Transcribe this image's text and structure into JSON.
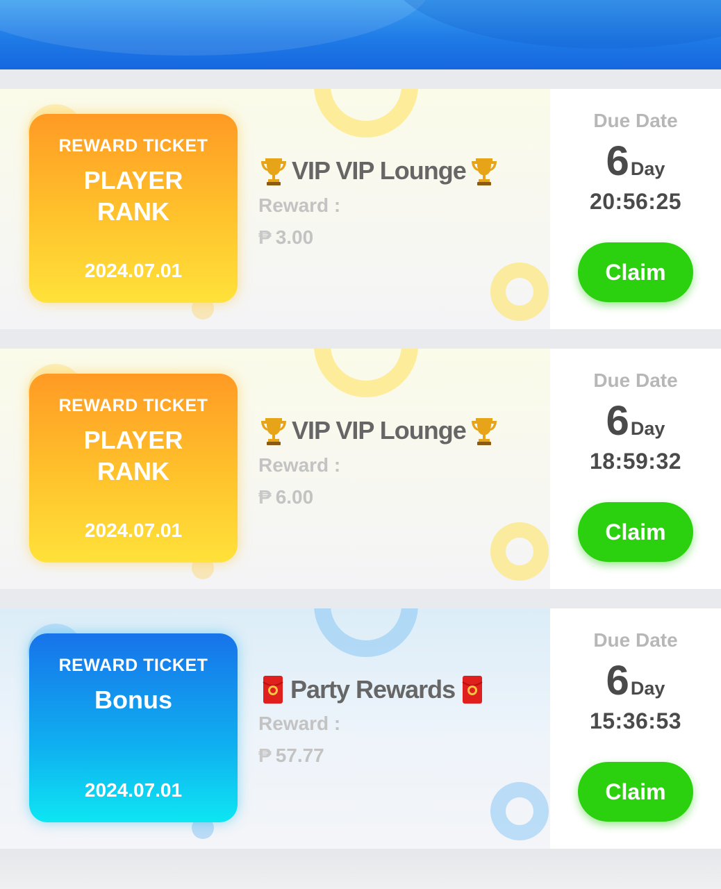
{
  "cards": [
    {
      "ticket_label": "REWARD TICKET",
      "ticket_type": "PLAYER\nRANK",
      "ticket_date": "2024.07.01",
      "title": "VIP VIP Lounge",
      "reward_label": "Reward :",
      "currency_symbol": "₱",
      "reward_amount": "3.00",
      "due_label": "Due Date",
      "days": "6",
      "days_unit": "Day",
      "time_left": "20:56:25",
      "claim_label": "Claim",
      "theme": "orange"
    },
    {
      "ticket_label": "REWARD TICKET",
      "ticket_type": "PLAYER\nRANK",
      "ticket_date": "2024.07.01",
      "title": "VIP VIP Lounge",
      "reward_label": "Reward :",
      "currency_symbol": "₱",
      "reward_amount": "6.00",
      "due_label": "Due Date",
      "days": "6",
      "days_unit": "Day",
      "time_left": "18:59:32",
      "claim_label": "Claim",
      "theme": "orange"
    },
    {
      "ticket_label": "REWARD TICKET",
      "ticket_type": "Bonus",
      "ticket_date": "2024.07.01",
      "title": "Party Rewards",
      "reward_label": "Reward :",
      "currency_symbol": "₱",
      "reward_amount": "57.77",
      "due_label": "Due Date",
      "days": "6",
      "days_unit": "Day",
      "time_left": "15:36:53",
      "claim_label": "Claim",
      "theme": "blue"
    }
  ],
  "icons": {
    "title_decoration_vip": "trophy-icon",
    "title_decoration_party": "red-envelope-icon"
  },
  "colors": {
    "header_blue": "#1f7be6",
    "claim_green": "#2bd10f",
    "ticket_orange": "#ff9a24",
    "ticket_yellow": "#ffe23a",
    "ticket_blue": "#1773ea",
    "ticket_cyan": "#0de6f2"
  }
}
